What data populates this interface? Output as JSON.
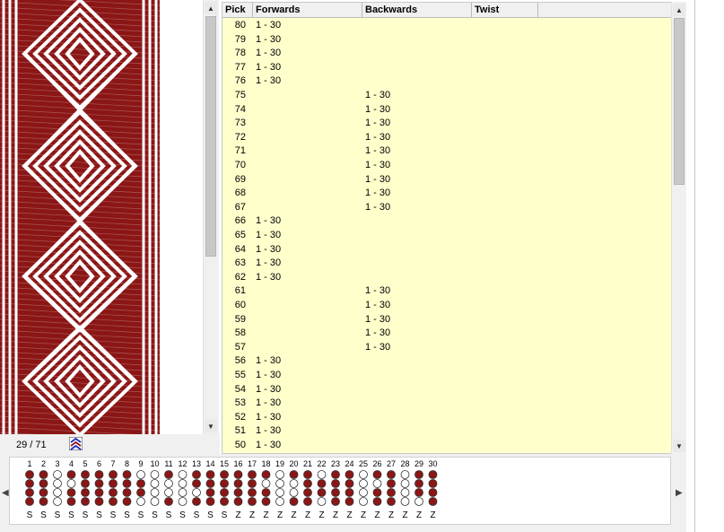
{
  "table": {
    "columns": [
      "Pick",
      "Forwards",
      "Backwards",
      "Twist"
    ],
    "rows": [
      {
        "pick": "80",
        "forwards": "1 - 30",
        "backwards": ""
      },
      {
        "pick": "79",
        "forwards": "1 - 30",
        "backwards": ""
      },
      {
        "pick": "78",
        "forwards": "1 - 30",
        "backwards": ""
      },
      {
        "pick": "77",
        "forwards": "1 - 30",
        "backwards": ""
      },
      {
        "pick": "76",
        "forwards": "1 - 30",
        "backwards": ""
      },
      {
        "pick": "75",
        "forwards": "",
        "backwards": "1 - 30"
      },
      {
        "pick": "74",
        "forwards": "",
        "backwards": "1 - 30"
      },
      {
        "pick": "73",
        "forwards": "",
        "backwards": "1 - 30"
      },
      {
        "pick": "72",
        "forwards": "",
        "backwards": "1 - 30"
      },
      {
        "pick": "71",
        "forwards": "",
        "backwards": "1 - 30"
      },
      {
        "pick": "70",
        "forwards": "",
        "backwards": "1 - 30"
      },
      {
        "pick": "69",
        "forwards": "",
        "backwards": "1 - 30"
      },
      {
        "pick": "68",
        "forwards": "",
        "backwards": "1 - 30"
      },
      {
        "pick": "67",
        "forwards": "",
        "backwards": "1 - 30"
      },
      {
        "pick": "66",
        "forwards": "1 - 30",
        "backwards": ""
      },
      {
        "pick": "65",
        "forwards": "1 - 30",
        "backwards": ""
      },
      {
        "pick": "64",
        "forwards": "1 - 30",
        "backwards": ""
      },
      {
        "pick": "63",
        "forwards": "1 - 30",
        "backwards": ""
      },
      {
        "pick": "62",
        "forwards": "1 - 30",
        "backwards": ""
      },
      {
        "pick": "61",
        "forwards": "",
        "backwards": "1 - 30"
      },
      {
        "pick": "60",
        "forwards": "",
        "backwards": "1 - 30"
      },
      {
        "pick": "59",
        "forwards": "",
        "backwards": "1 - 30"
      },
      {
        "pick": "58",
        "forwards": "",
        "backwards": "1 - 30"
      },
      {
        "pick": "57",
        "forwards": "",
        "backwards": "1 - 30"
      },
      {
        "pick": "56",
        "forwards": "1 - 30",
        "backwards": ""
      },
      {
        "pick": "55",
        "forwards": "1 - 30",
        "backwards": ""
      },
      {
        "pick": "54",
        "forwards": "1 - 30",
        "backwards": ""
      },
      {
        "pick": "53",
        "forwards": "1 - 30",
        "backwards": ""
      },
      {
        "pick": "52",
        "forwards": "1 - 30",
        "backwards": ""
      },
      {
        "pick": "51",
        "forwards": "1 - 30",
        "backwards": ""
      },
      {
        "pick": "50",
        "forwards": "1 - 30",
        "backwards": ""
      }
    ]
  },
  "position_label": "29 / 71",
  "cards": {
    "numbers": [
      "1",
      "2",
      "3",
      "4",
      "5",
      "6",
      "7",
      "8",
      "9",
      "10",
      "11",
      "12",
      "13",
      "14",
      "15",
      "16",
      "17",
      "18",
      "19",
      "20",
      "21",
      "22",
      "23",
      "24",
      "25",
      "26",
      "27",
      "28",
      "29",
      "30"
    ],
    "threading": [
      "S",
      "S",
      "S",
      "S",
      "S",
      "S",
      "S",
      "S",
      "S",
      "S",
      "S",
      "S",
      "S",
      "S",
      "S",
      "Z",
      "Z",
      "Z",
      "Z",
      "Z",
      "Z",
      "Z",
      "Z",
      "Z",
      "Z",
      "Z",
      "Z",
      "Z",
      "Z",
      "Z"
    ],
    "holes": [
      [
        1,
        1,
        1,
        1
      ],
      [
        1,
        1,
        1,
        1
      ],
      [
        0,
        0,
        0,
        0
      ],
      [
        1,
        0,
        1,
        1
      ],
      [
        1,
        1,
        1,
        1
      ],
      [
        1,
        1,
        1,
        1
      ],
      [
        1,
        1,
        1,
        1
      ],
      [
        1,
        1,
        1,
        1
      ],
      [
        0,
        1,
        1,
        0
      ],
      [
        0,
        0,
        0,
        0
      ],
      [
        1,
        0,
        0,
        1
      ],
      [
        0,
        0,
        0,
        0
      ],
      [
        1,
        1,
        0,
        1
      ],
      [
        1,
        1,
        1,
        1
      ],
      [
        1,
        1,
        1,
        1
      ],
      [
        1,
        1,
        1,
        1
      ],
      [
        1,
        1,
        1,
        1
      ],
      [
        1,
        0,
        1,
        1
      ],
      [
        0,
        0,
        0,
        0
      ],
      [
        1,
        0,
        0,
        1
      ],
      [
        1,
        1,
        1,
        1
      ],
      [
        0,
        1,
        1,
        0
      ],
      [
        1,
        1,
        1,
        1
      ],
      [
        1,
        1,
        1,
        1
      ],
      [
        0,
        0,
        0,
        0
      ],
      [
        1,
        0,
        1,
        1
      ],
      [
        1,
        1,
        1,
        1
      ],
      [
        0,
        0,
        0,
        0
      ],
      [
        1,
        1,
        1,
        0
      ],
      [
        1,
        1,
        1,
        1
      ]
    ]
  },
  "colors": {
    "thread_dark": "#8b1616",
    "thread_light": "#ffffff",
    "table_bg": "#ffffcc",
    "ui_bg": "#f0f0f0"
  },
  "icons": {
    "scroll_up": "▲",
    "scroll_down": "▼",
    "left": "◀",
    "right": "▶"
  }
}
